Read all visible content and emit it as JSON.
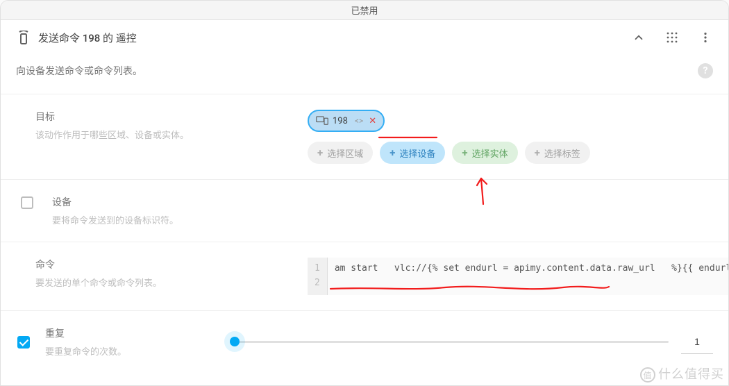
{
  "window_title": "已禁用",
  "header": {
    "title": "发送命令 198 的 遥控"
  },
  "description": "向设备发送命令或命令列表。",
  "target": {
    "label": "目标",
    "sub": "该动作作用于哪些区域、设备或实体。",
    "selected_device": "198"
  },
  "chips": {
    "area": "选择区域",
    "device": "选择设备",
    "entity": "选择实体",
    "tag": "选择标签"
  },
  "device": {
    "label": "设备",
    "sub": "要将命令发送到的设备标识符。"
  },
  "command": {
    "label": "命令",
    "sub": "要发送的单个命令或命令列表。",
    "lines": {
      "l1": "1",
      "l2": "2"
    },
    "code": "am start   vlc://{% set endurl = apimy.content.data.raw_url   %}{{ endurl }}"
  },
  "repeat": {
    "label": "重复",
    "sub": "要重复命令的次数。",
    "value": "1"
  },
  "watermark": "什么值得买"
}
